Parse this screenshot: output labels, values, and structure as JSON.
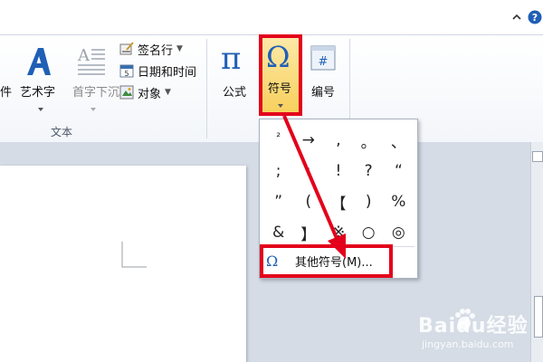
{
  "ribbon": {
    "text_group": {
      "label": "文本",
      "partial_left_label": "件",
      "wordart_label": "艺术字",
      "dropcap_label": "首字下沉",
      "signature_line_label": "签名行",
      "date_time_label": "日期和时间",
      "object_label": "对象"
    },
    "symbols_group": {
      "formula_label": "公式",
      "symbol_label": "符号",
      "numbering_label": "编号"
    }
  },
  "symbol_dropdown": {
    "symbols": [
      "²",
      "→",
      ",",
      "。",
      "、",
      ";",
      ":",
      "!",
      "?",
      "“",
      "”",
      "(",
      "【",
      ")",
      "%",
      "&",
      "】",
      "※",
      "○",
      "◎"
    ],
    "more_symbols_label": "其他符号(M)..."
  },
  "watermark": {
    "brand": "Baidu经验",
    "url": "jingyan.baidu.com"
  },
  "colors": {
    "highlight_red": "#e3001b",
    "icon_blue": "#1f5fb5",
    "ribbon_bg": "#f3f6fa"
  }
}
